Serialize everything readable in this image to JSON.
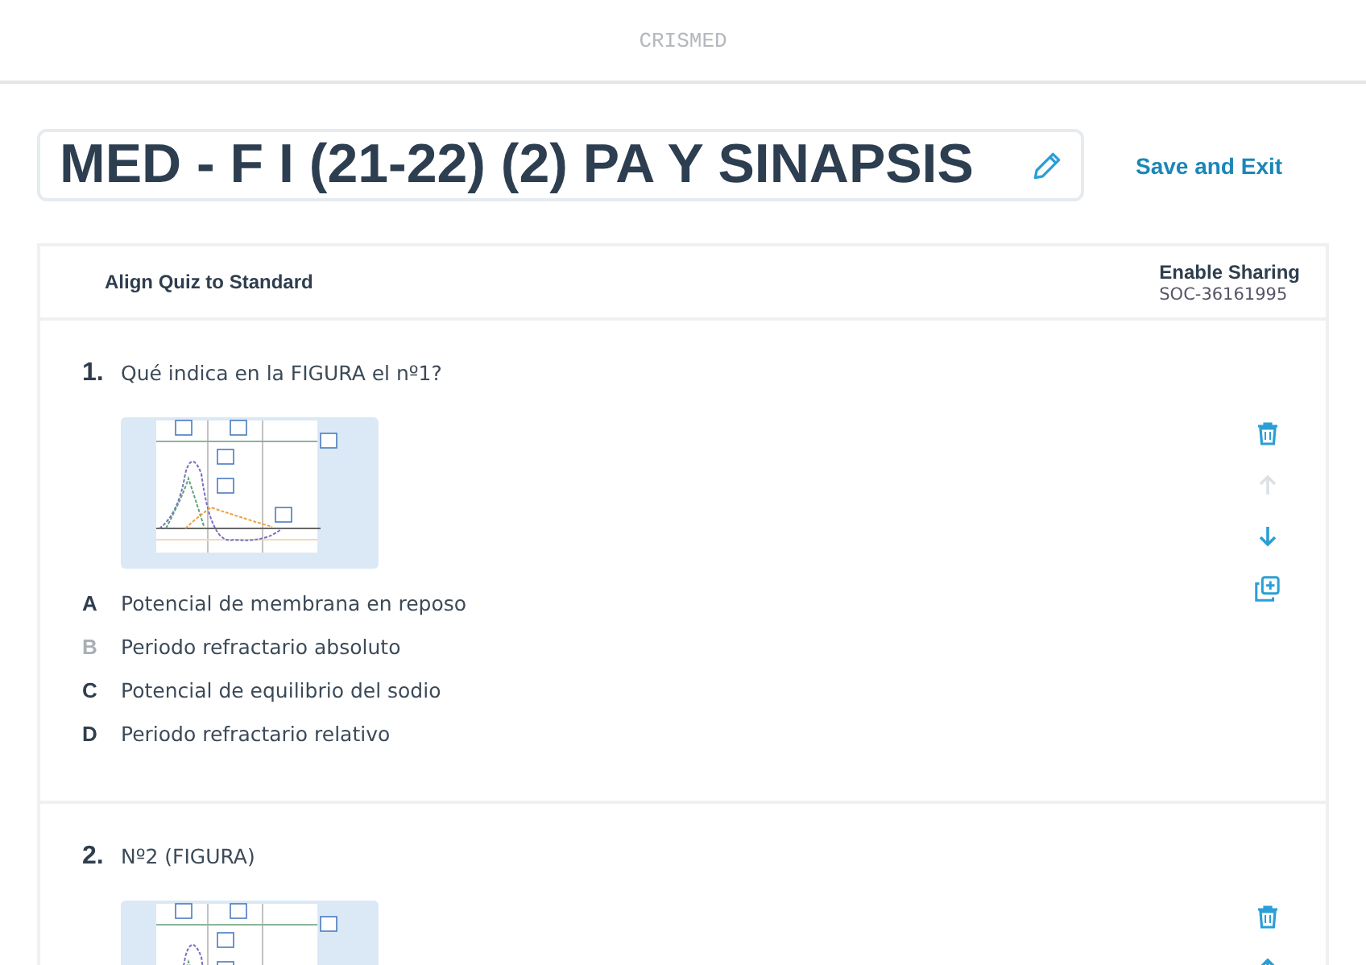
{
  "brand": "CRISMED",
  "title": "MED - F I (21-22) (2) PA Y SINAPSIS",
  "save_button": "Save and Exit",
  "toolbar": {
    "align_label": "Align Quiz to Standard",
    "sharing_label": "Enable Sharing",
    "code": "SOC-36161995"
  },
  "questions": [
    {
      "number": "1.",
      "text": "Qué indica en la FIGURA el nº1?",
      "move_up_disabled": true,
      "move_down_disabled": false,
      "options": [
        {
          "letter": "A",
          "text": "Potencial de membrana en reposo",
          "dimmed": false
        },
        {
          "letter": "B",
          "text": "Periodo refractario absoluto",
          "dimmed": true
        },
        {
          "letter": "C",
          "text": "Potencial de equilibrio del sodio",
          "dimmed": false
        },
        {
          "letter": "D",
          "text": "Periodo refractario relativo",
          "dimmed": false
        }
      ]
    },
    {
      "number": "2.",
      "text": "Nº2 (FIGURA)",
      "move_up_disabled": false
    }
  ]
}
